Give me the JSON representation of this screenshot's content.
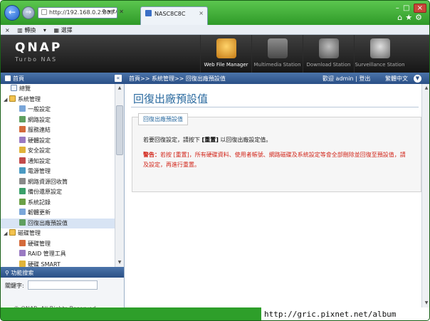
{
  "browser": {
    "url": "http://192.168.0.2:808",
    "tab_title": "NASC8C8C",
    "toolbar_items": [
      "轉換",
      "選擇"
    ]
  },
  "header": {
    "logo": "QNAP",
    "logo_sub": "Turbo NAS",
    "apps": [
      {
        "label": "Web File Manager",
        "icon": "web-file-manager-icon"
      },
      {
        "label": "Multimedia Station",
        "icon": "multimedia-station-icon"
      },
      {
        "label": "Download Station",
        "icon": "download-station-icon"
      },
      {
        "label": "Surveillance Station",
        "icon": "surveillance-station-icon"
      }
    ]
  },
  "bar": {
    "home": "首頁",
    "breadcrumb": "首頁>> 系統管理>> 回復出廠預設值",
    "welcome": "歡迎 admin | 登出",
    "language": "繁體中文"
  },
  "tree": [
    {
      "label": "總覽",
      "level": "l0"
    },
    {
      "label": "系統管理",
      "level": "l0g",
      "group": true
    },
    {
      "label": "一般設定",
      "level": "l1"
    },
    {
      "label": "網路設定",
      "level": "l1"
    },
    {
      "label": "服務連結",
      "level": "l1"
    },
    {
      "label": "硬體設定",
      "level": "l1"
    },
    {
      "label": "安全設定",
      "level": "l1"
    },
    {
      "label": "通知設定",
      "level": "l1"
    },
    {
      "label": "電源管理",
      "level": "l1"
    },
    {
      "label": "網路資源回收筒",
      "level": "l1"
    },
    {
      "label": "備份還原設定",
      "level": "l1"
    },
    {
      "label": "系統記錄",
      "level": "l1"
    },
    {
      "label": "韌體更新",
      "level": "l1"
    },
    {
      "label": "回復出廠預設值",
      "level": "l1",
      "selected": true
    },
    {
      "label": "磁碟管理",
      "level": "l0g",
      "group": true
    },
    {
      "label": "硬碟管理",
      "level": "l1"
    },
    {
      "label": "RAID 管理工具",
      "level": "l1"
    },
    {
      "label": "硬碟 SMART",
      "level": "l1"
    }
  ],
  "search": {
    "title": "功能搜索",
    "keyword_label": "關鍵字:"
  },
  "main": {
    "title": "回復出廠預設值",
    "panel_title": "回復出廠預設值",
    "instruction_prefix": "若要回復設定，請按下",
    "instruction_key": "[重置]",
    "instruction_suffix": "以回復出廠設定值。",
    "warn_label": "警告：",
    "warn_text_1": "若按 [重置]，所有硬碟資料、使用者帳號、網路磁碟及系統設定等會全部刪除並回復至預設值，請",
    "warn_text_2": "及設定，再進行重置。"
  },
  "footer": {
    "copyright": "© QNAP, All Rights Reserved",
    "watermark": "http://gric.pixnet.net/album"
  }
}
